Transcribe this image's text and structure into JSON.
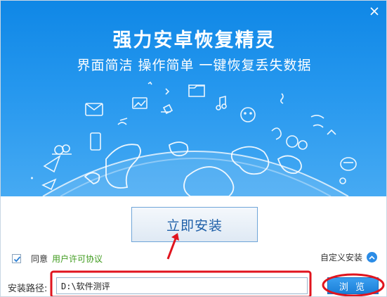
{
  "header": {
    "title": "强力安卓恢复精灵",
    "subtitle": "界面简洁 操作简单 一键恢复丢失数据"
  },
  "install": {
    "label": "立即安装"
  },
  "agree": {
    "checked": true,
    "text": "同意",
    "link_text": "用户许可协议"
  },
  "custom_install": {
    "label": "自定义安装"
  },
  "path": {
    "label": "安装路径:",
    "value": "D:\\软件测评"
  },
  "browse": {
    "label": "浏 览"
  },
  "colors": {
    "banner": "#1e90ea",
    "accent": "#2b8ce6",
    "link": "#3f9b1e",
    "annotation": "#e0141e"
  }
}
